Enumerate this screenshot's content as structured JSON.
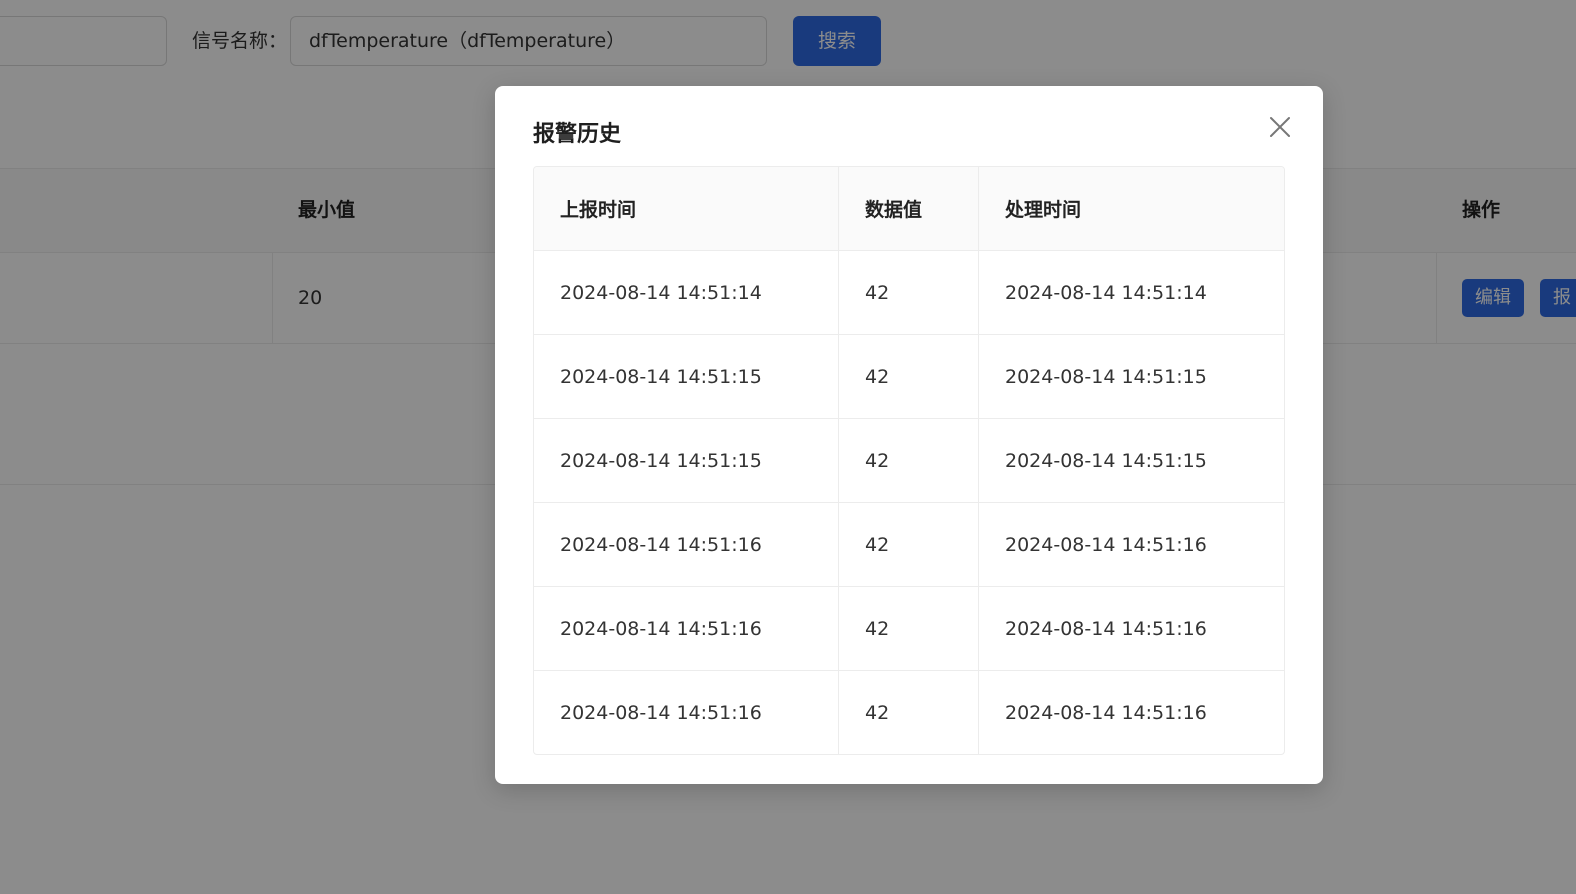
{
  "background": {
    "filter": {
      "signal_label": "信号名称：",
      "signal_value": "dfTemperature（dfTemperature）",
      "search_button": "搜索"
    },
    "table": {
      "headers": {
        "min_value": "最小值",
        "actions": "操作"
      },
      "row": {
        "min_value": "20",
        "edit_button": "编辑",
        "alarm_button": "报"
      }
    }
  },
  "modal": {
    "title": "报警历史",
    "close_icon": "close-icon",
    "columns": [
      "上报时间",
      "数据值",
      "处理时间"
    ],
    "rows": [
      [
        "2024-08-14 14:51:14",
        "42",
        "2024-08-14 14:51:14"
      ],
      [
        "2024-08-14 14:51:15",
        "42",
        "2024-08-14 14:51:15"
      ],
      [
        "2024-08-14 14:51:15",
        "42",
        "2024-08-14 14:51:15"
      ],
      [
        "2024-08-14 14:51:16",
        "42",
        "2024-08-14 14:51:16"
      ],
      [
        "2024-08-14 14:51:16",
        "42",
        "2024-08-14 14:51:16"
      ],
      [
        "2024-08-14 14:51:16",
        "42",
        "2024-08-14 14:51:16"
      ]
    ]
  },
  "colors": {
    "primary": "#2f6be4",
    "overlay": "rgba(0,0,0,0.45)"
  }
}
